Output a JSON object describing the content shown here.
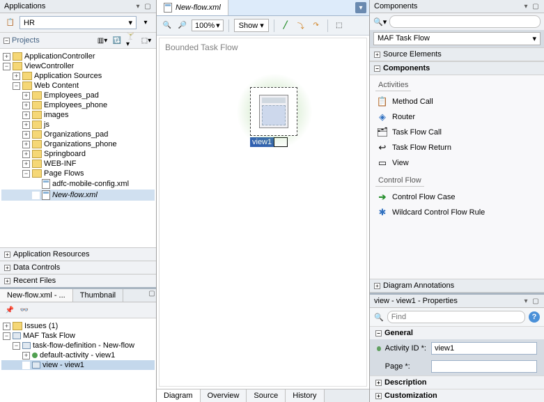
{
  "left": {
    "panels": {
      "applications": "Applications",
      "app_res": "Application Resources",
      "data_ctl": "Data Controls",
      "recent": "Recent Files"
    },
    "app_dropdown": "HR",
    "projects_label": "Projects",
    "tree": {
      "app_ctrl": "ApplicationController",
      "view_ctrl": "ViewController",
      "app_src": "Application Sources",
      "web_content": "Web Content",
      "emp_pad": "Employees_pad",
      "emp_phone": "Employees_phone",
      "images": "images",
      "js": "js",
      "org_pad": "Organizations_pad",
      "org_phone": "Organizations_phone",
      "springboard": "Springboard",
      "webinf": "WEB-INF",
      "page_flows": "Page Flows",
      "adfc": "adfc-mobile-config.xml",
      "newflow": "New-flow.xml"
    }
  },
  "bottom_left": {
    "tab1": "New-flow.xml - ...",
    "tab2": "Thumbnail",
    "issues": "Issues (1)",
    "maf": "MAF Task Flow",
    "tfd": "task-flow-definition - New-flow",
    "default_act": "default-activity - view1",
    "view": "view - view1"
  },
  "center": {
    "tab_title": "New-flow.xml",
    "zoom": "100%",
    "show": "Show",
    "canvas_title": "Bounded Task Flow",
    "node_label": "view1",
    "tabs": {
      "diagram": "Diagram",
      "overview": "Overview",
      "source": "Source",
      "history": "History"
    }
  },
  "right": {
    "components": "Components",
    "combo": "MAF Task Flow",
    "src_elem": "Source Elements",
    "comp_sec": "Components",
    "activities": "Activities",
    "items_act": {
      "method": "Method Call",
      "router": "Router",
      "tfc": "Task Flow Call",
      "tfr": "Task Flow Return",
      "view": "View"
    },
    "ctrl_flow": "Control Flow",
    "items_cf": {
      "cfc": "Control Flow Case",
      "wild": "Wildcard Control Flow Rule"
    },
    "diag_ann": "Diagram Annotations",
    "props_title": "view - view1 - Properties",
    "find": "Find",
    "general": "General",
    "activity_id_lbl": "Activity ID *:",
    "activity_id_val": "view1",
    "page_lbl": "Page *:",
    "page_val": "",
    "description": "Description",
    "customization": "Customization"
  }
}
